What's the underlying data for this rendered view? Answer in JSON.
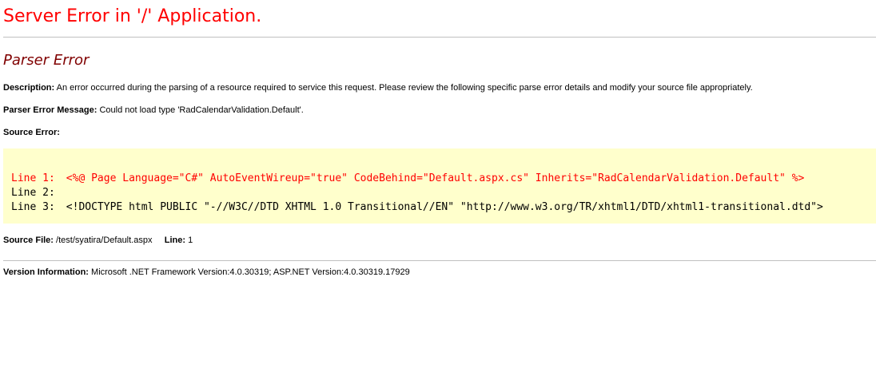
{
  "header": {
    "title": "Server Error in '/' Application."
  },
  "error": {
    "type": "Parser Error",
    "description_label": "Description:",
    "description_text": "An error occurred during the parsing of a resource required to service this request. Please review the following specific parse error details and modify your source file appropriately.",
    "message_label": "Parser Error Message:",
    "message_text": "Could not load type 'RadCalendarValidation.Default'.",
    "source_error_label": "Source Error:"
  },
  "source_code": {
    "lines": [
      {
        "label": "Line 1:",
        "code": "<%@ Page Language=\"C#\" AutoEventWireup=\"true\" CodeBehind=\"Default.aspx.cs\" Inherits=\"RadCalendarValidation.Default\" %>"
      },
      {
        "label": "Line 2:",
        "code": ""
      },
      {
        "label": "Line 3:",
        "code": "<!DOCTYPE html PUBLIC \"-//W3C//DTD XHTML 1.0 Transitional//EN\" \"http://www.w3.org/TR/xhtml1/DTD/xhtml1-transitional.dtd\">"
      }
    ]
  },
  "source_file": {
    "label": "Source File:",
    "value": "/test/syatira/Default.aspx",
    "line_label": "Line:",
    "line_value": "1"
  },
  "version": {
    "label": "Version Information:",
    "value": "Microsoft .NET Framework Version:4.0.30319; ASP.NET Version:4.0.30319.17929"
  },
  "colors": {
    "title": "#ff0000",
    "subtitle": "#800000",
    "code_background": "#ffffcc",
    "error_line": "#ff0000"
  }
}
